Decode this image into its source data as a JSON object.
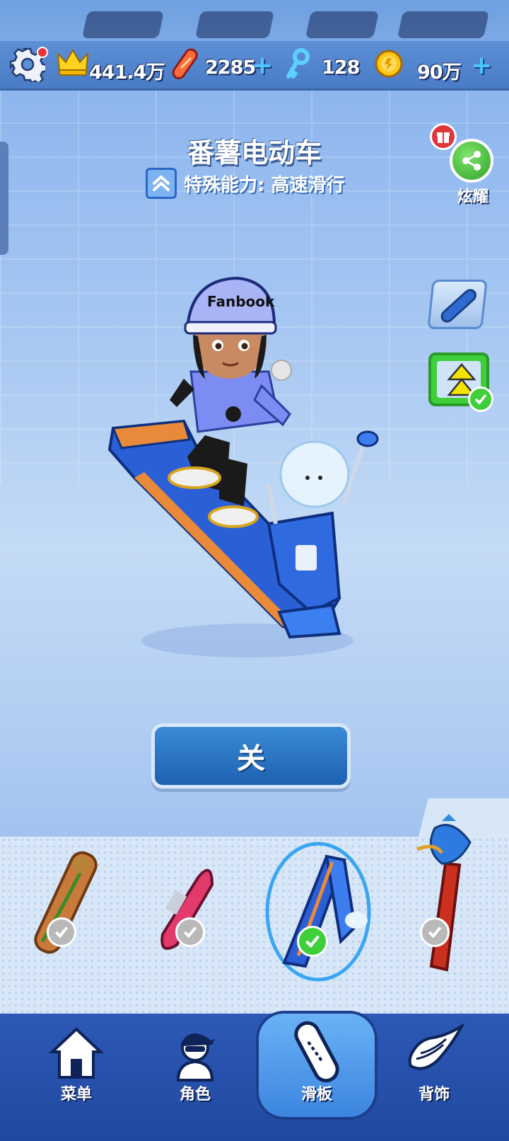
{
  "topbar": {
    "crown_score": "441.4万",
    "hoverboards": "2285",
    "keys": "128",
    "coins": "90万"
  },
  "board": {
    "name": "番薯电动车",
    "ability": "特殊能力: 高速滑行"
  },
  "share": {
    "label": "炫耀"
  },
  "character": {
    "helmet_text": "Fanbook"
  },
  "close_button": {
    "label": "关"
  },
  "board_list": [
    {
      "id": "board-1",
      "owned": true,
      "selected": false
    },
    {
      "id": "board-2",
      "owned": true,
      "selected": false
    },
    {
      "id": "board-3",
      "owned": true,
      "selected": true
    },
    {
      "id": "board-4",
      "owned": true,
      "selected": false
    }
  ],
  "nav": {
    "menu": "菜单",
    "character": "角色",
    "board": "滑板",
    "back_item": "背饰",
    "active": "滑板"
  },
  "colors": {
    "accent": "#2ea42a",
    "primary_button": "#1e61b2",
    "nav_bg": "#2049a0"
  }
}
